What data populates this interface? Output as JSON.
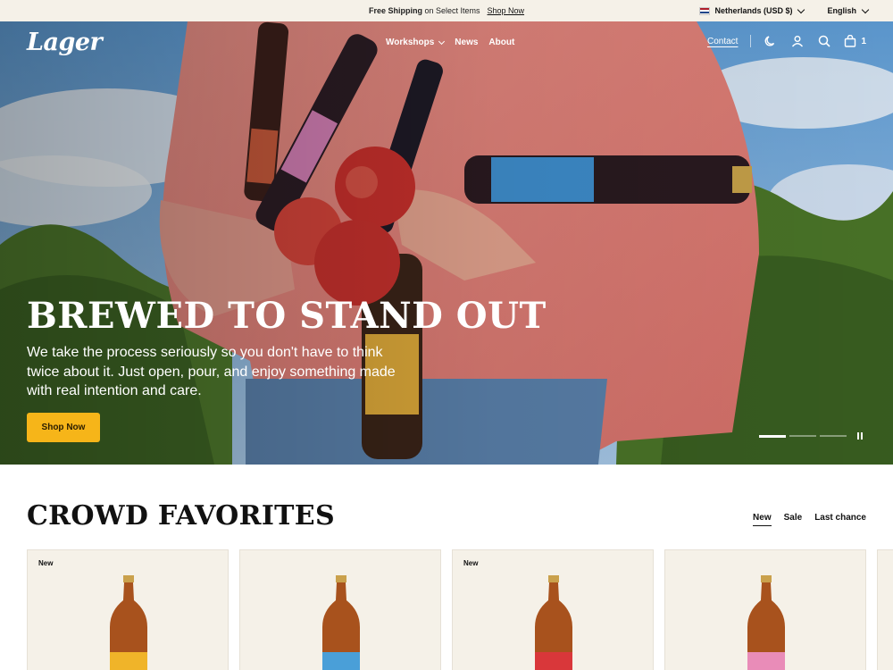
{
  "announcement": {
    "bold_text": "Free Shipping",
    "text": "on Select Items",
    "link": "Shop Now",
    "country": "Netherlands (USD $)",
    "language": "English"
  },
  "nav": {
    "logo": "Lager",
    "menu": [
      "Workshops",
      "News",
      "About"
    ],
    "contact": "Contact",
    "cart_count": "1",
    "icons": [
      "theme-toggle-icon",
      "account-icon",
      "search-icon",
      "cart-icon"
    ]
  },
  "hero": {
    "title": "BREWED TO STAND OUT",
    "text": "We take the process seriously so you don't have to think twice about it. Just open, pour, and enjoy something made with real intention and care.",
    "button": "Shop Now",
    "slides_count": 3,
    "active_slide": 1
  },
  "favorites": {
    "title": "CROWD FAVORITES",
    "tabs": [
      "New",
      "Sale",
      "Last chance"
    ],
    "active_tab": "New",
    "cards": [
      {
        "badge": "New",
        "label_color": "#f0b429"
      },
      {
        "badge": "",
        "label_color": "#4a9fd8"
      },
      {
        "badge": "New",
        "label_color": "#d9373a"
      },
      {
        "badge": "",
        "label_color": "#e98cb8"
      }
    ]
  },
  "colors": {
    "accent": "#f6b519",
    "cream": "#f5f1e8"
  }
}
